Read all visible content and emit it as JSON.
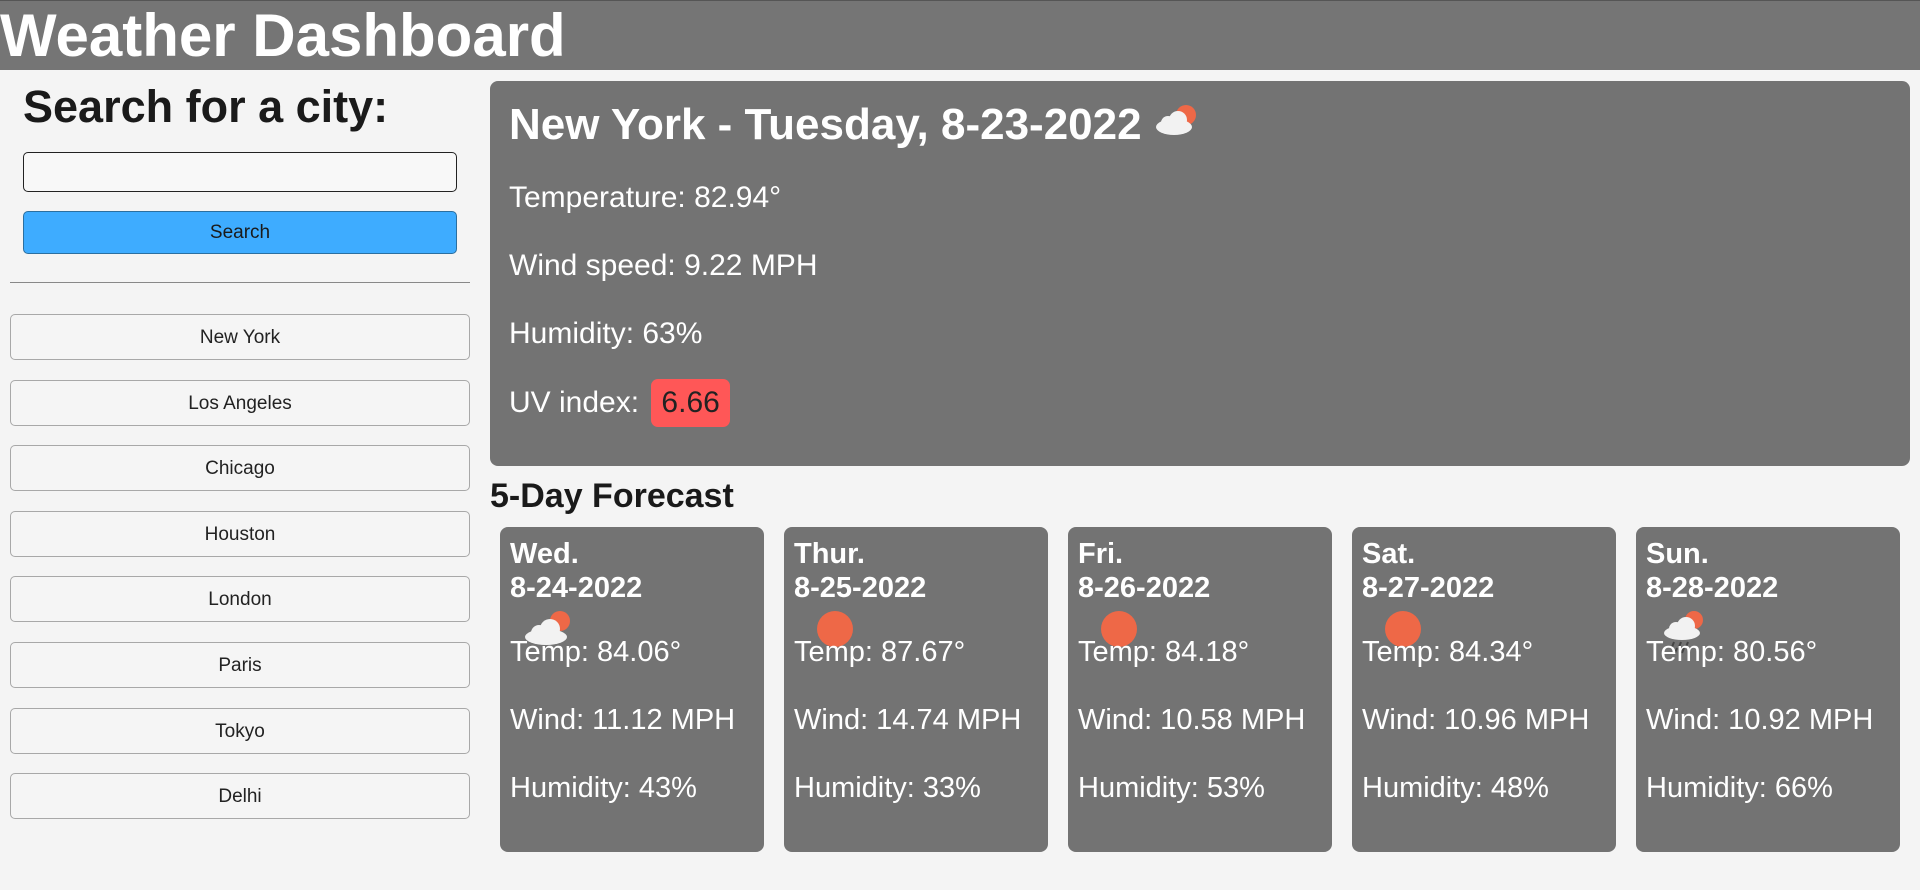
{
  "header": {
    "title": "Weather Dashboard"
  },
  "sidebar": {
    "search_heading": "Search for a city:",
    "search_input_value": "",
    "search_input_placeholder": "",
    "search_button_label": "Search",
    "cities": [
      "New York",
      "Los Angeles",
      "Chicago",
      "Houston",
      "London",
      "Paris",
      "Tokyo",
      "Delhi"
    ]
  },
  "current": {
    "title": "New York - Tuesday, 8-23-2022",
    "icon": "partly-cloudy-icon",
    "temperature": "Temperature: 82.94°",
    "wind": "Wind speed: 9.22 MPH",
    "humidity": "Humidity: 63%",
    "uv_label": "UV index:",
    "uv_value": "6.66",
    "uv_color": "#ff5757"
  },
  "forecast": {
    "heading": "5-Day Forecast",
    "days": [
      {
        "day": "Wed.",
        "date": "8-24-2022",
        "icon": "partly-cloudy-icon",
        "temp": "Temp: 84.06°",
        "wind": "Wind: 11.12 MPH",
        "humidity": "Humidity: 43%"
      },
      {
        "day": "Thur.",
        "date": "8-25-2022",
        "icon": "sun-icon",
        "temp": "Temp: 87.67°",
        "wind": "Wind: 14.74 MPH",
        "humidity": "Humidity: 33%"
      },
      {
        "day": "Fri.",
        "date": "8-26-2022",
        "icon": "sun-icon",
        "temp": "Temp: 84.18°",
        "wind": "Wind: 10.58 MPH",
        "humidity": "Humidity: 53%"
      },
      {
        "day": "Sat.",
        "date": "8-27-2022",
        "icon": "sun-icon",
        "temp": "Temp: 84.34°",
        "wind": "Wind: 10.96 MPH",
        "humidity": "Humidity: 48%"
      },
      {
        "day": "Sun.",
        "date": "8-28-2022",
        "icon": "rain-cloud-sun-icon",
        "temp": "Temp: 80.56°",
        "wind": "Wind: 10.92 MPH",
        "humidity": "Humidity: 66%"
      }
    ]
  },
  "colors": {
    "header_bg": "#757575",
    "card_bg": "#737373",
    "search_button": "#3eacff",
    "sun": "#ee6847",
    "page_bg": "#f4f4f4"
  }
}
